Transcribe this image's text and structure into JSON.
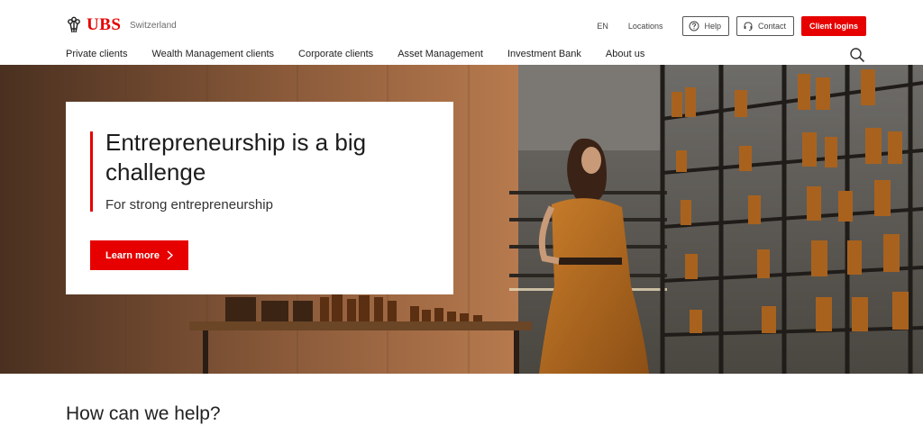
{
  "header": {
    "brand": "UBS",
    "region": "Switzerland",
    "language": "EN",
    "locations": "Locations",
    "help": "Help",
    "contact": "Contact",
    "client_logins": "Client logins"
  },
  "nav": {
    "items": [
      "Private clients",
      "Wealth Management clients",
      "Corporate clients",
      "Asset Management",
      "Investment Bank",
      "About us"
    ]
  },
  "hero": {
    "title": "Entrepreneurship is a big challenge",
    "subtitle": "For strong entrepreneurship",
    "cta": "Learn more"
  },
  "section": {
    "title": "How can we help?"
  },
  "colors": {
    "brand_red": "#e60000",
    "text": "#1c1c1c"
  },
  "icons": [
    "ubs-keys-logo-icon",
    "help-circle-icon",
    "headset-icon",
    "search-icon",
    "chevron-right-icon"
  ]
}
